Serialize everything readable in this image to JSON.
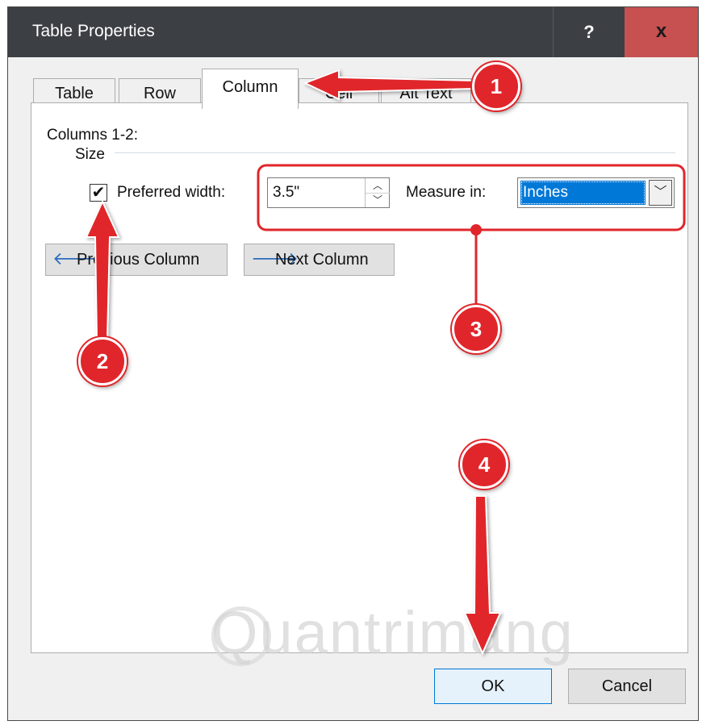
{
  "window": {
    "title": "Table Properties",
    "help_label": "?",
    "close_label": "x"
  },
  "tabs": [
    {
      "label": "Table",
      "active": false
    },
    {
      "label": "Row",
      "active": false
    },
    {
      "label": "Column",
      "active": true
    },
    {
      "label": "Cell",
      "active": false
    },
    {
      "label": "Alt Text",
      "active": false
    }
  ],
  "column_tab": {
    "columns_label": "Columns 1-2:",
    "size_label": "Size",
    "preferred_width_label": "Preferred width:",
    "preferred_width_checked": true,
    "width_value": "3.5\"",
    "measure_in_label": "Measure in:",
    "measure_in_value": "Inches",
    "prev_column_label": "Previous Column",
    "next_column_label": "Next Column"
  },
  "footer": {
    "ok_label": "OK",
    "cancel_label": "Cancel"
  },
  "annotations": {
    "callouts": [
      "1",
      "2",
      "3",
      "4"
    ],
    "accent_color": "#e0262b",
    "watermark": "Quantrimang"
  },
  "icons": {
    "prev_arrow": "arrow-left-icon",
    "next_arrow": "arrow-right-icon",
    "dropdown": "chevron-down-icon",
    "spin_up": "chevron-up-icon",
    "spin_down": "chevron-down-icon",
    "check": "checkmark-icon"
  }
}
